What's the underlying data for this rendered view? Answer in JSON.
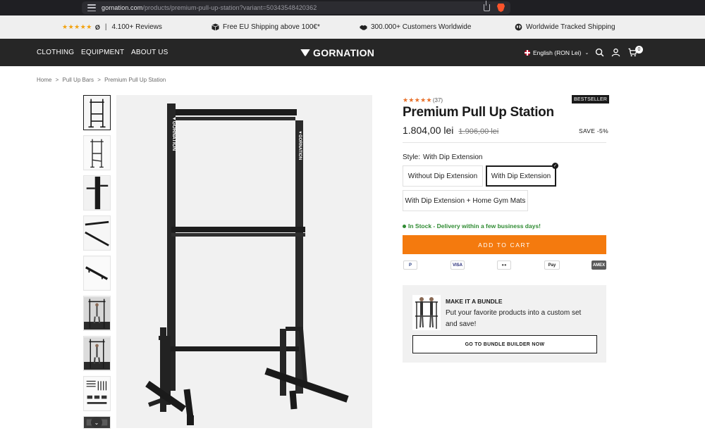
{
  "browser": {
    "url_host": "gornation.com",
    "url_path": "/products/premium-pull-up-station?variant=50343548420362"
  },
  "announcement": {
    "stars": "★★★★★",
    "reviews_logo": "Ø",
    "reviews": "4.100+ Reviews",
    "shipping": "Free EU Shipping above 100€*",
    "customers": "300.000+ Customers Worldwide",
    "tracked": "Worldwide Tracked Shipping"
  },
  "nav": {
    "clothing": "CLOTHING",
    "equipment": "EQUIPMENT",
    "about": "ABOUT US",
    "logo": "GORNATION",
    "language": "English (RON Lei)",
    "cart_count": "0",
    "icons": [
      "search-icon",
      "account-icon",
      "cart-icon"
    ]
  },
  "breadcrumb": {
    "home": "Home",
    "category": "Pull Up Bars",
    "current": "Premium Pull Up Station",
    "separator": ">"
  },
  "product": {
    "rating_stars": "★★★★★",
    "rating_count": "(37)",
    "badge": "BESTSELLER",
    "title": "Premium Pull Up Station",
    "price": "1.804,00 lei",
    "old_price": "1.906,00 lei",
    "save": "SAVE -5%",
    "style_label": "Style:",
    "style_value": "With Dip Extension",
    "options": [
      "Without Dip Extension",
      "With Dip Extension",
      "With Dip Extension + Home Gym Mats"
    ],
    "selected_option": 1,
    "stock": "In Stock - Delivery within a few business days!",
    "add_to_cart": "ADD TO CART",
    "payment_methods": [
      "P",
      "VISA",
      "●●",
      "Pay",
      "AMEX"
    ]
  },
  "bundle": {
    "title": "MAKE IT A BUNDLE",
    "text": "Put your favorite products into a custom set and save!",
    "button": "GO TO BUNDLE BUILDER NOW"
  },
  "colors": {
    "accent": "#f47a0e",
    "nav_bg": "#262626",
    "stock_green": "#2f8b32",
    "star": "#e8702a"
  }
}
